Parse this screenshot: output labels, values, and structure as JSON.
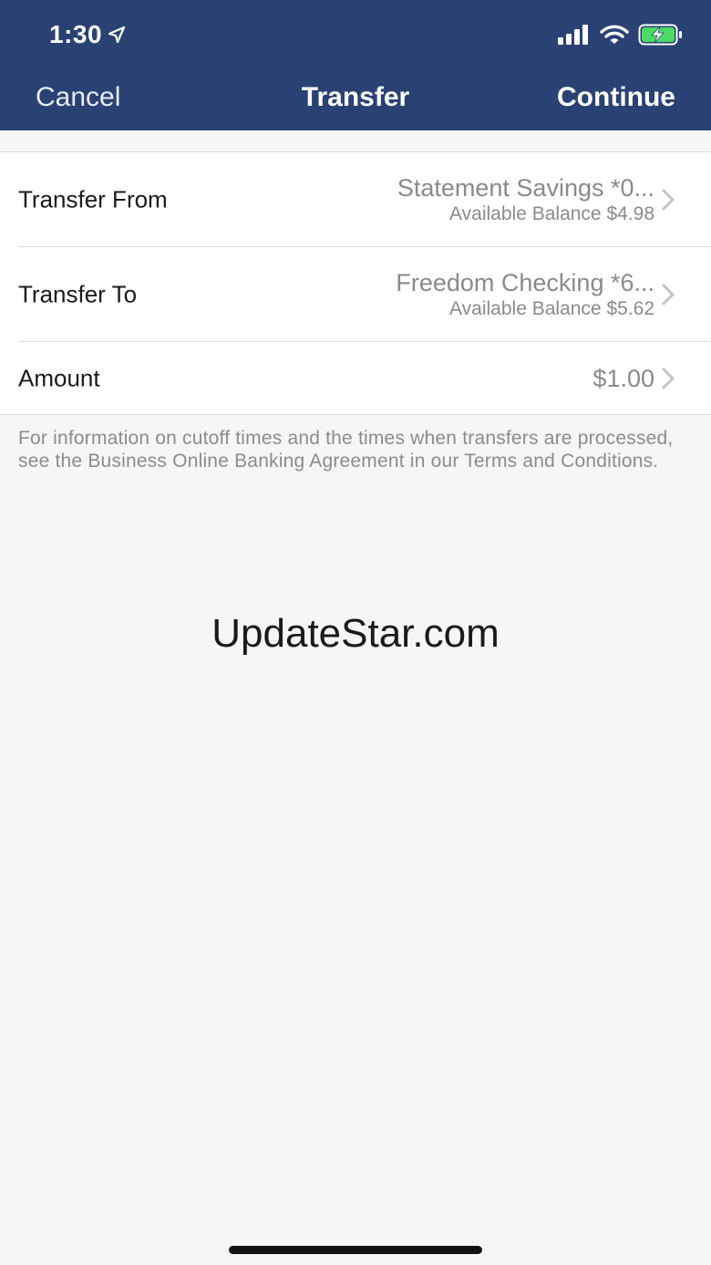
{
  "status_bar": {
    "time": "1:30"
  },
  "nav": {
    "cancel_label": "Cancel",
    "title": "Transfer",
    "continue_label": "Continue"
  },
  "form": {
    "transfer_from": {
      "label": "Transfer From",
      "account": "Statement Savings *0...",
      "balance": "Available Balance $4.98"
    },
    "transfer_to": {
      "label": "Transfer To",
      "account": "Freedom Checking *6...",
      "balance": "Available Balance $5.62"
    },
    "amount": {
      "label": "Amount",
      "value": "$1.00"
    }
  },
  "info_text": "For information on cutoff times and the times when transfers are processed, see the Business Online Banking Agreement in our Terms and Conditions.",
  "watermark": "UpdateStar.com",
  "colors": {
    "header_bg": "#2a4174",
    "page_bg": "#f6f6f6",
    "battery_charging": "#4cd964"
  },
  "icons": {
    "location": "location-arrow-icon",
    "signal": "cellular-signal-icon",
    "wifi": "wifi-icon",
    "battery": "battery-charging-icon",
    "chevron": "chevron-right-icon"
  }
}
